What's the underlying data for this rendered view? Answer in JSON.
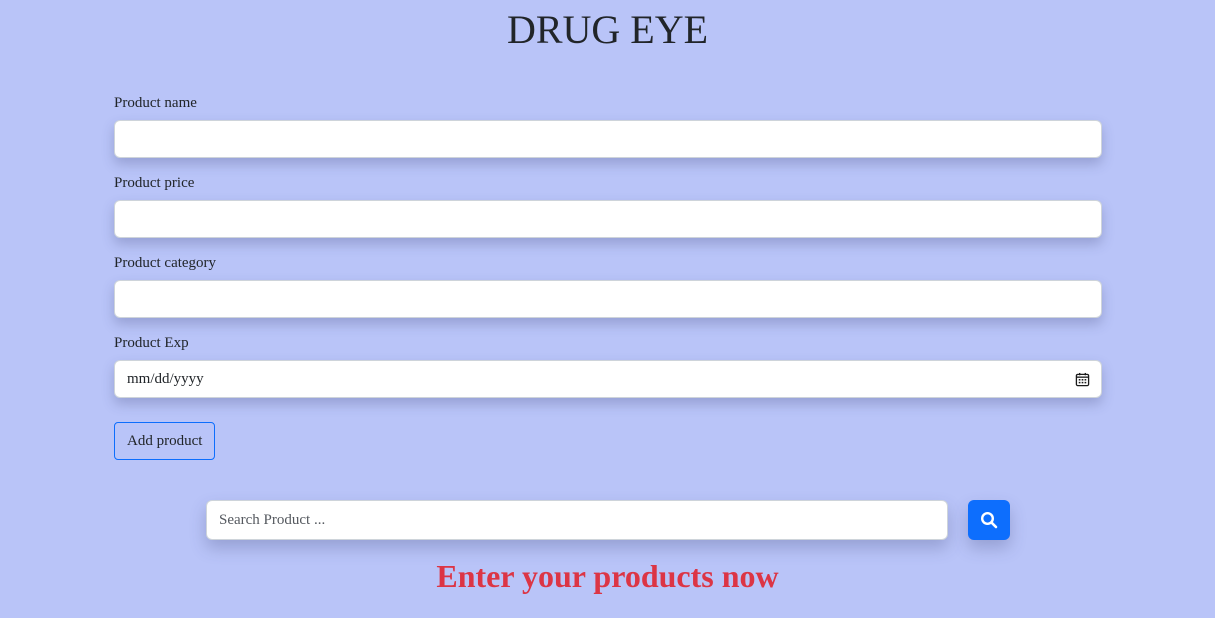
{
  "header": {
    "title": "DRUG EYE"
  },
  "form": {
    "fields": [
      {
        "label": "Product name",
        "value": ""
      },
      {
        "label": "Product price",
        "value": ""
      },
      {
        "label": "Product category",
        "value": ""
      },
      {
        "label": "Product Exp",
        "value": "mm/dd/yyyy"
      }
    ],
    "add_button_label": "Add product"
  },
  "search": {
    "placeholder": "Search Product ...",
    "value": "",
    "button_icon": "search-icon"
  },
  "message": {
    "text": "Enter your products now"
  },
  "colors": {
    "background": "#b9c4f8",
    "primary": "#0d6efd",
    "danger": "#dc3545"
  },
  "icons": {
    "date_picker": "calendar-icon",
    "search": "search-icon"
  }
}
